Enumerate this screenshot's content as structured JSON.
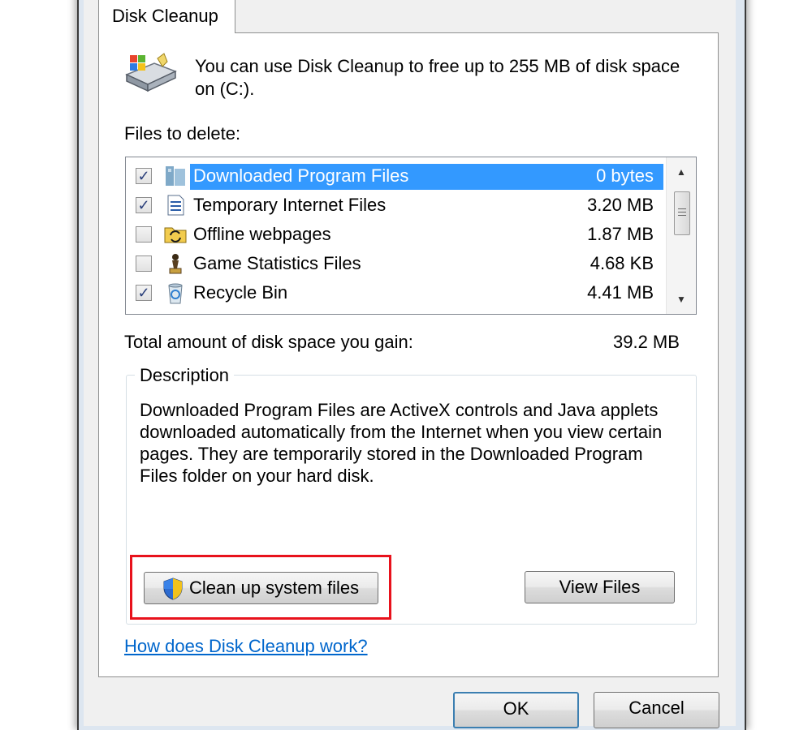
{
  "window": {
    "tab_label": "Disk Cleanup"
  },
  "intro": {
    "text": "You can use Disk Cleanup to free up to 255 MB of disk space on  (C:)."
  },
  "files": {
    "label": "Files to delete:",
    "items": [
      {
        "name": "Downloaded Program Files",
        "size": "0 bytes",
        "checked": true,
        "selected": true,
        "icon": "program-files-icon"
      },
      {
        "name": "Temporary Internet Files",
        "size": "3.20 MB",
        "checked": true,
        "selected": false,
        "icon": "document-icon"
      },
      {
        "name": "Offline webpages",
        "size": "1.87 MB",
        "checked": false,
        "selected": false,
        "icon": "sync-folder-icon"
      },
      {
        "name": "Game Statistics Files",
        "size": "4.68 KB",
        "checked": false,
        "selected": false,
        "icon": "chess-piece-icon"
      },
      {
        "name": "Recycle Bin",
        "size": "4.41 MB",
        "checked": true,
        "selected": false,
        "icon": "recycle-bin-icon"
      }
    ]
  },
  "total": {
    "label": "Total amount of disk space you gain:",
    "value": "39.2 MB"
  },
  "description": {
    "legend": "Description",
    "text": "Downloaded Program Files are ActiveX controls and Java applets downloaded automatically from the Internet when you view certain pages. They are temporarily stored in the Downloaded Program Files folder on your hard disk."
  },
  "buttons": {
    "cleanup_system": "Clean up system files",
    "view_files": "View Files",
    "ok": "OK",
    "cancel": "Cancel"
  },
  "help_link": "How does Disk Cleanup work?",
  "colors": {
    "selection": "#3399ff",
    "link": "#0066cc",
    "highlight_box": "#e8121c"
  }
}
